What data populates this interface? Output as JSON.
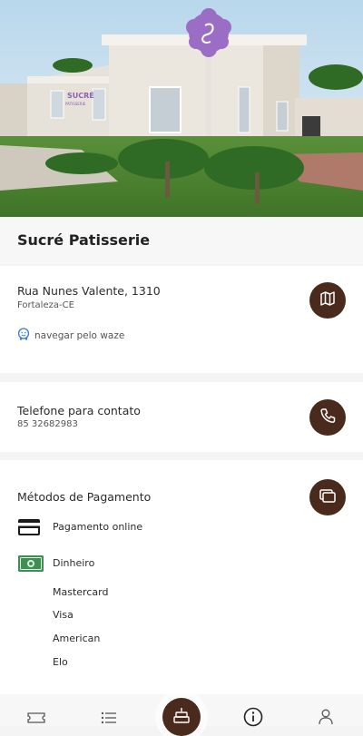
{
  "store": {
    "name": "Sucré Patisserie",
    "sign_text": "SUCRÉ",
    "sign_sub": "PATISSERIE"
  },
  "address": {
    "street": "Rua Nunes Valente, 1310",
    "city": "Fortaleza-CE",
    "waze_label": "navegar pelo waze",
    "map_icon": "map-icon"
  },
  "phone": {
    "label": "Telefone para contato",
    "number": "85 32682983",
    "phone_icon": "phone-icon"
  },
  "payment": {
    "title": "Métodos de Pagamento",
    "methods": [
      {
        "label": "Pagamento online",
        "icon": "credit-card-icon"
      },
      {
        "label": "Dinheiro",
        "icon": "cash-icon"
      }
    ],
    "brands": [
      "Mastercard",
      "Visa",
      "American",
      "Elo"
    ]
  },
  "nav": {
    "items": [
      "ticket-icon",
      "list-icon",
      "cake-icon",
      "info-icon",
      "user-icon"
    ]
  },
  "colors": {
    "accent": "#4a2a1c",
    "logo_purple": "#9b6dc5",
    "cash_green": "#3f8f55"
  }
}
